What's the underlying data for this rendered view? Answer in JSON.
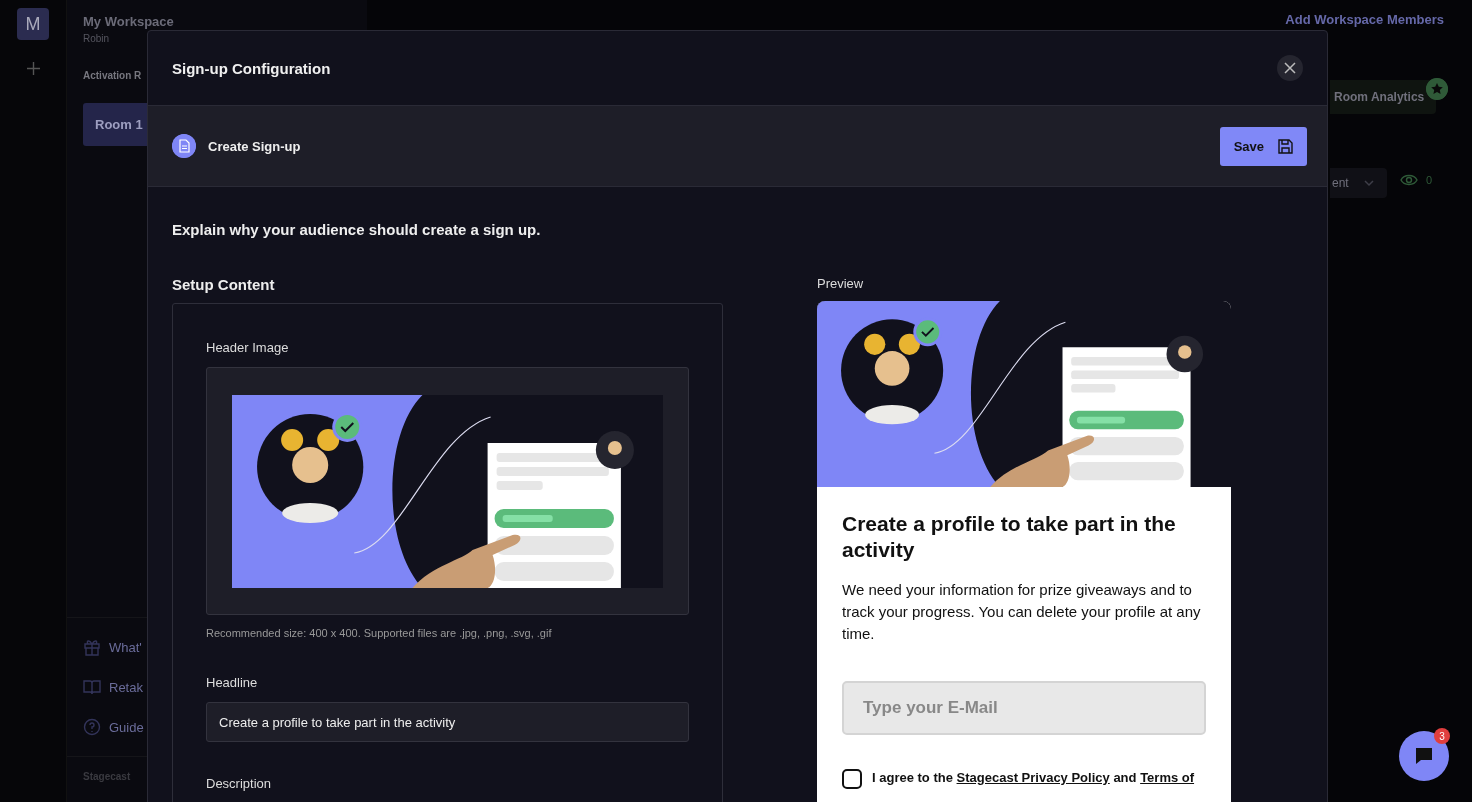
{
  "workspace": {
    "avatar_letter": "M",
    "name": "My Workspace",
    "user": "Robin"
  },
  "background": {
    "section_label": "Activation R",
    "room_tab": "Room 1",
    "add_members": "Add Workspace Members",
    "analytics_button": "Room Analytics",
    "dropdown_text": "ent",
    "view_count": "0",
    "footer_links": [
      "What'",
      "Retak",
      "Guide"
    ],
    "brand": "Stagecast"
  },
  "modal": {
    "title": "Sign-up Configuration",
    "step": "Create Sign-up",
    "save": "Save",
    "intro": "Explain why your audience should create a sign up.",
    "setup_title": "Setup Content",
    "header_image_label": "Header Image",
    "image_hint": "Recommended size: 400 x 400. Supported files are .jpg, .png, .svg, .gif",
    "fields": [
      {
        "label": "Headline",
        "value": "Create a profile to take part in the activity"
      },
      {
        "label": "Description"
      }
    ]
  },
  "preview": {
    "label": "Preview",
    "headline": "Create a profile to take part in the activity",
    "description": "We need your information for prize giveaways and to track your progress. You can delete your profile at any time.",
    "email_placeholder": "Type your E-Mail",
    "consent": {
      "checked": false,
      "parts": [
        {
          "kind": "text",
          "text": "I agree to the"
        },
        {
          "kind": "link",
          "text": "Stagecast Privacy Policy"
        },
        {
          "kind": "text",
          "text": "and"
        },
        {
          "kind": "link",
          "text": "Terms of"
        }
      ]
    }
  },
  "chat": {
    "badge": "3"
  }
}
